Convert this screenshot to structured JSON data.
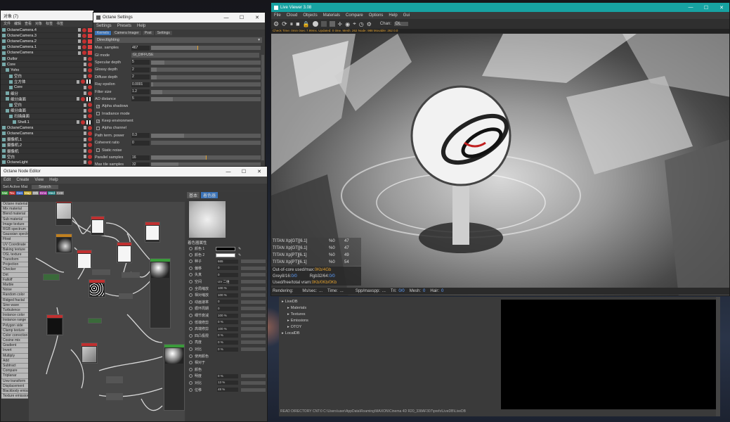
{
  "objects_window": {
    "title": "对象 (7)",
    "menu": [
      "文件",
      "编辑",
      "查看",
      "对象",
      "标签",
      "书签"
    ],
    "rows": [
      {
        "name": "OctaneCamera.4",
        "indent": 0
      },
      {
        "name": "OctaneCamera.3",
        "indent": 0
      },
      {
        "name": "OctaneCamera.2",
        "indent": 0
      },
      {
        "name": "OctaneCamera.1",
        "indent": 0
      },
      {
        "name": "OctaneCamera",
        "indent": 0
      },
      {
        "name": "Outlor",
        "indent": 0
      },
      {
        "name": "Core",
        "indent": 0
      },
      {
        "name": "Yoho",
        "indent": 1
      },
      {
        "name": "空白",
        "indent": 2
      },
      {
        "name": "立方体",
        "indent": 2
      },
      {
        "name": "Core",
        "indent": 2
      },
      {
        "name": "细分",
        "indent": 1
      },
      {
        "name": "细分曲面",
        "indent": 1
      },
      {
        "name": "空白",
        "indent": 2
      },
      {
        "name": "细分曲面",
        "indent": 1
      },
      {
        "name": "扫描曲面",
        "indent": 2
      },
      {
        "name": "Shell.1",
        "indent": 3
      },
      {
        "name": "OctaneCamera",
        "indent": 0
      },
      {
        "name": "OctaneCamera",
        "indent": 0
      },
      {
        "name": "摄像机.1",
        "indent": 0
      },
      {
        "name": "摄像机.2",
        "indent": 0
      },
      {
        "name": "摄像机",
        "indent": 0
      },
      {
        "name": "空白",
        "indent": 0
      },
      {
        "name": "OctaneLight",
        "indent": 0
      },
      {
        "name": "OctaneSky",
        "indent": 0
      }
    ]
  },
  "settings_window": {
    "title": "Octane Settings",
    "menu": [
      "Settings",
      "Presets",
      "Help"
    ],
    "tabs": [
      "Kernels",
      "Camera Imager",
      "Post",
      "Settings"
    ],
    "kernel": "Directlighting",
    "rows": [
      {
        "label": "Max. samples",
        "value": "467",
        "fill": 0.42,
        "mark": 0.42
      },
      {
        "label": "GI mode",
        "value": "GI_DIFFUSE",
        "type": "select"
      },
      {
        "label": "Specular depth",
        "value": "5",
        "fill": 0.12
      },
      {
        "label": "Glossy depth",
        "value": "2",
        "fill": 0.05
      },
      {
        "label": "Diffuse depth",
        "value": "2",
        "fill": 0.05
      },
      {
        "label": "Ray epsilon",
        "value": "0.0001",
        "fill": 0.02
      },
      {
        "label": "Filter size",
        "value": "1.2",
        "fill": 0.1
      },
      {
        "label": "AO distance",
        "value": "5",
        "fill": 0.2
      },
      {
        "label": "Alpha shadows",
        "type": "check",
        "checked": true
      },
      {
        "label": "Irradiance mode",
        "type": "check",
        "checked": false
      },
      {
        "label": "Keep environment",
        "type": "check",
        "checked": true
      },
      {
        "label": "Alpha channel",
        "type": "check",
        "checked": false
      },
      {
        "label": "Path term. power",
        "value": "0.3",
        "fill": 0.3
      },
      {
        "label": "Coherent ratio",
        "value": "0",
        "fill": 0
      },
      {
        "label": "Static noise",
        "type": "check",
        "checked": false
      },
      {
        "label": "Parallel samples",
        "value": "16",
        "fill": 0.5,
        "mark": 0.5
      },
      {
        "label": "Max tile samples",
        "value": "32",
        "fill": 0.25
      }
    ]
  },
  "node_editor": {
    "title": "Octane Node Editor",
    "menu": [
      "Edit",
      "Create",
      "View",
      "Help"
    ],
    "toolbar": {
      "set_active": "Set Active Mat",
      "search": "Search"
    },
    "filter_tags": [
      {
        "label": "Mat",
        "color": "#3a9a3a"
      },
      {
        "label": "Tex",
        "color": "#c03030"
      },
      {
        "label": "Gen",
        "color": "#3060c0"
      },
      {
        "label": "Map",
        "color": "#c0a020"
      },
      {
        "label": "Oth",
        "color": "#909090"
      },
      {
        "label": "Ems",
        "color": "#a030a0"
      },
      {
        "label": "Med",
        "color": "#208080"
      },
      {
        "label": "C4D",
        "color": "#707070"
      }
    ],
    "node_list": [
      "Octane material",
      "Mix material",
      "Blend material",
      "Sub material",
      "Image texture",
      "RGB spectrum",
      "Gaussian spectrum",
      "Float",
      "UV Coordinate",
      "Baking texture",
      "OSL texture",
      "Transform",
      "Projection",
      "Checker",
      "Dirt",
      "Falloff",
      "Marble",
      "Noise",
      "Random color",
      "Ridged fractal",
      "Sine wave",
      "Turbulence",
      "Instance color",
      "Instance range",
      "Polygon side",
      "Clamp texture",
      "Color correction",
      "Cosine mix",
      "Gradient",
      "Invert",
      "Multiply",
      "Add",
      "Subtract",
      "Compare",
      "Triplanar",
      "Uvw transform",
      "Displacement",
      "Blackbody emission",
      "Texture emission"
    ],
    "attr_panel": {
      "tabs": [
        "基本",
        "着色器"
      ],
      "section": "着色器属性",
      "color1_label": "颜色 1",
      "color2_label": "颜色 2",
      "rows": [
        {
          "label": "种子",
          "value": "665"
        },
        {
          "label": "偏移",
          "value": "0"
        },
        {
          "label": "失真",
          "value": "0"
        },
        {
          "label": "空间",
          "value": "UV 二维"
        },
        {
          "label": "全局缩放",
          "value": "100 %"
        },
        {
          "label": "相对缩放",
          "value": "100 %"
        },
        {
          "label": "动画速率",
          "value": "0"
        },
        {
          "label": "循环周期",
          "value": "0"
        },
        {
          "label": "细节衰减",
          "value": "100 %"
        },
        {
          "label": "低端修剪",
          "value": "0 %"
        },
        {
          "label": "高端修剪",
          "value": "100 %"
        },
        {
          "label": "四凸极限",
          "value": "0 %"
        },
        {
          "label": "亮度",
          "value": "0 %"
        },
        {
          "label": "对比",
          "value": "0 %"
        },
        {
          "label": "使用颜色",
          "value": ""
        },
        {
          "label": "相对于",
          "value": ""
        },
        {
          "label": "颜色",
          "value": ""
        },
        {
          "label": "明度",
          "value": "0 %"
        },
        {
          "label": "对比",
          "value": "13 %"
        },
        {
          "label": "位移",
          "value": "48 %"
        }
      ]
    }
  },
  "live_viewer": {
    "title": "Live Viewer 3.08",
    "menu": [
      "File",
      "Cloud",
      "Objects",
      "Materials",
      "Compare",
      "Options",
      "Help",
      "Gui"
    ],
    "channel_label": "Chan:",
    "channel_value": "DL",
    "status_line": "Check Time: 0min 0sec 7.99ms. Updated: 0 time. Mesh: 262 Node: 988 Movable: 262 0.0",
    "gpu_rows": [
      {
        "name": "TITAN Xp[GT][6.1]",
        "pct": "%0",
        "temp": "47"
      },
      {
        "name": "TITAN Xp[GT][6.1]",
        "pct": "%0",
        "temp": "47"
      },
      {
        "name": "TITAN Xp[PT][6.1]",
        "pct": "%0",
        "temp": "49"
      },
      {
        "name": "TITAN Xp[PT][6.1]",
        "pct": "%0",
        "temp": "54"
      }
    ],
    "memory": {
      "out_of_core_label": "Out-of-core used/max:",
      "out_of_core_value": "0Kb/4Gb",
      "grey_label": "Grey8/16:",
      "grey_value": "0/0",
      "rgb_label": "Rgb32/64:",
      "rgb_value": "0/0",
      "vram_label": "Used/free/total vram:",
      "vram_value": "0Kb/0Kb/0Kb"
    },
    "render_status": {
      "rendering": "Rendering:",
      "ms_label": "Ms/sec:",
      "ms_value": "...",
      "time_label": "Time:",
      "time_value": "...",
      "spp_label": "Spp/maxspp:",
      "spp_value": "...",
      "tri_label": "Tri:",
      "tri_value": "0/0",
      "mesh_label": "Mesh:",
      "mesh_value": "0",
      "hair_label": "Hair:",
      "hair_value": "0"
    }
  },
  "livedb": {
    "tree": [
      {
        "label": "LiveDB",
        "indent": 0
      },
      {
        "label": "Materials",
        "indent": 1
      },
      {
        "label": "Textures",
        "indent": 1
      },
      {
        "label": "Emissions",
        "indent": 1
      },
      {
        "label": "OTOY",
        "indent": 1
      },
      {
        "label": "LocalDB",
        "indent": 0
      }
    ],
    "status_path": "READ DIRECTORY CNT:0 C:\\Users\\user\\AppData\\Roaming\\MAXON\\Cinema 4D R20_338AF307\\prefs\\LiveDB\\LiveDB"
  },
  "colors": {
    "accent_teal": "#17a2a2",
    "orange_mark": "#e0a030",
    "green_text": "#60c060",
    "blue_text": "#60a0ff"
  }
}
